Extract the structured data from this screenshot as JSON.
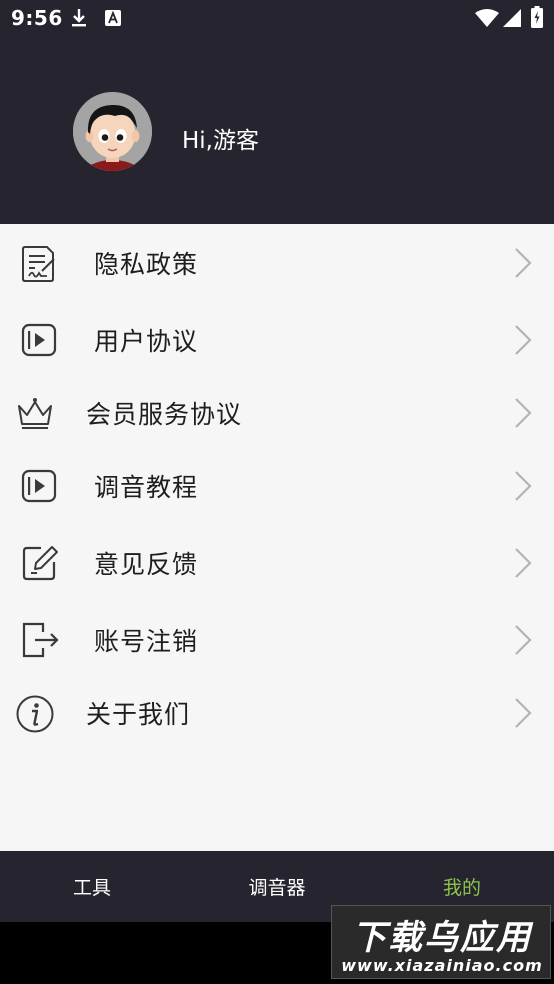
{
  "status_bar": {
    "time": "9:56",
    "icons": [
      "download-icon",
      "a-icon",
      "wifi-icon",
      "signal-icon",
      "battery-icon"
    ]
  },
  "profile": {
    "greeting": "Hi,游客",
    "avatar": "cartoon-boy-avatar"
  },
  "menu": {
    "items": [
      {
        "label": "隐私政策",
        "icon": "document-sign-icon"
      },
      {
        "label": "用户协议",
        "icon": "play-box-icon"
      },
      {
        "label": "会员服务协议",
        "icon": "crown-icon"
      },
      {
        "label": "调音教程",
        "icon": "play-box-icon"
      },
      {
        "label": "意见反馈",
        "icon": "edit-icon"
      },
      {
        "label": "账号注销",
        "icon": "logout-icon"
      },
      {
        "label": "关于我们",
        "icon": "info-icon"
      }
    ],
    "chevron_icon": "chevron-right-icon"
  },
  "tab_bar": {
    "tabs": [
      {
        "label": "工具",
        "active": false
      },
      {
        "label": "调音器",
        "active": false
      },
      {
        "label": "我的",
        "active": true
      }
    ],
    "active_color": "#8bc34a"
  },
  "watermark": {
    "title": "下载乌应用",
    "url": "www.xiazainiao.com"
  },
  "colors": {
    "header_bg": "#25242f",
    "content_bg": "#f6f6f6",
    "text": "#1e1e1e"
  }
}
